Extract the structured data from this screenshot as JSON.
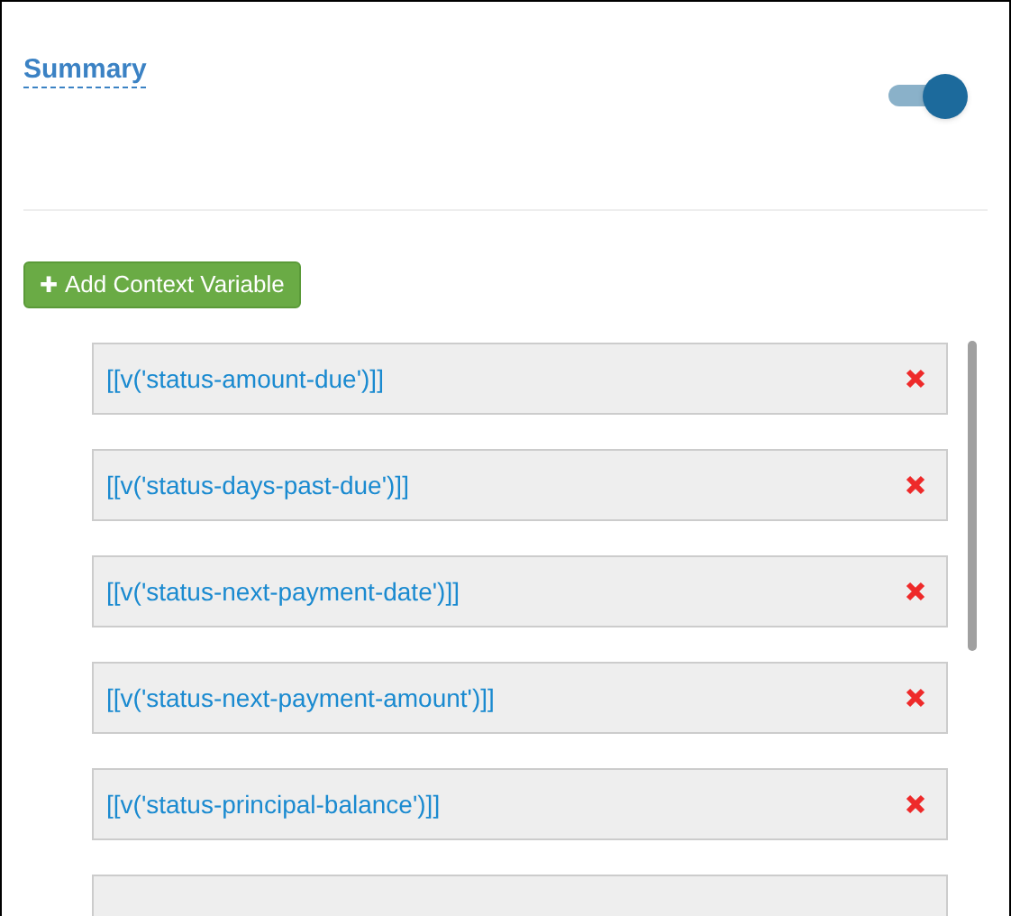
{
  "section": {
    "title": "Summary",
    "toggle": {
      "on": true
    }
  },
  "add_button": {
    "icon": "✚",
    "label": "Add Context Variable"
  },
  "variables": [
    {
      "text": "[[v('status-amount-due')]]"
    },
    {
      "text": "[[v('status-days-past-due')]]"
    },
    {
      "text": "[[v('status-next-payment-date')]]"
    },
    {
      "text": "[[v('status-next-payment-amount')]]"
    },
    {
      "text": "[[v('status-principal-balance')]]"
    }
  ]
}
